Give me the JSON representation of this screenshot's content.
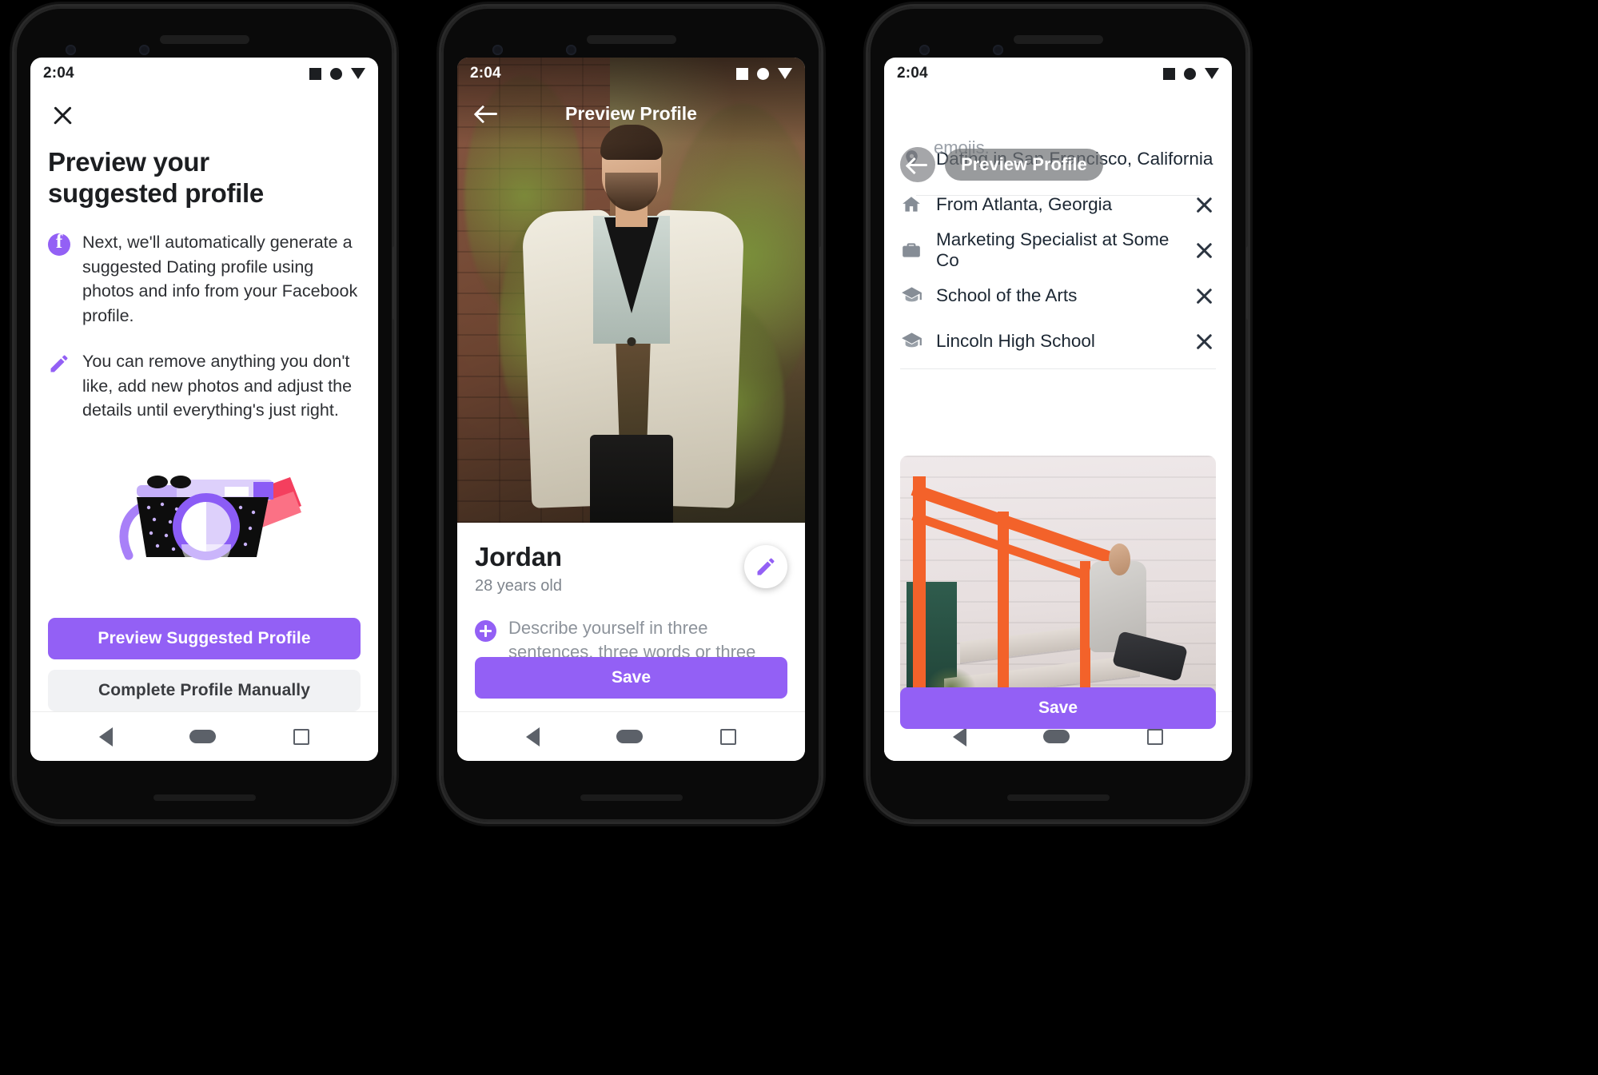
{
  "meta": {
    "status_time": "2:04"
  },
  "phone1": {
    "status_time": "2:04",
    "close_label": "×",
    "title": "Preview your suggested profile",
    "bullets": [
      {
        "icon": "facebook-icon",
        "text": "Next, we'll automatically generate a suggested Dating profile using photos and info from your Facebook profile."
      },
      {
        "icon": "pencil-icon",
        "text": "You can remove anything you don't like, add new photos and adjust the details until everything's just right."
      }
    ],
    "illustration": "camera-photos-illustration",
    "primary_button": "Preview Suggested Profile",
    "secondary_button": "Complete Profile Manually"
  },
  "phone2": {
    "status_time": "2:04",
    "header_title": "Preview Profile",
    "person_name": "Jordan",
    "person_age": "28 years old",
    "describe_prompt": "Describe yourself in three sentences, three words or three emojis.",
    "save_button": "Save",
    "edit_icon": "pencil-icon",
    "back_icon": "arrow-left-icon"
  },
  "phone3": {
    "status_time": "2:04",
    "ghost_text": "emojis.",
    "header_title": "Preview Profile",
    "back_icon": "arrow-left-icon",
    "info_items": [
      {
        "icon": "location-pin-icon",
        "label": "Dating in San Francisco, California",
        "removable": false
      },
      {
        "icon": "home-icon",
        "label": "From Atlanta, Georgia",
        "removable": true
      },
      {
        "icon": "briefcase-icon",
        "label": "Marketing Specialist at Some Co",
        "removable": true
      },
      {
        "icon": "graduation-cap-icon",
        "label": "School of the Arts",
        "removable": true
      },
      {
        "icon": "graduation-cap-icon",
        "label": "Lincoln High School",
        "removable": true
      }
    ],
    "save_button": "Save"
  },
  "navbar": {
    "back": "back-triangle-icon",
    "home": "home-pill-icon",
    "recents": "recents-square-icon"
  },
  "colors": {
    "accent_purple": "#9360f5",
    "secondary_gray": "#f1f2f4",
    "text_primary": "#1c1e21",
    "text_muted": "#8d939b",
    "device_black": "#0a0a0a"
  }
}
